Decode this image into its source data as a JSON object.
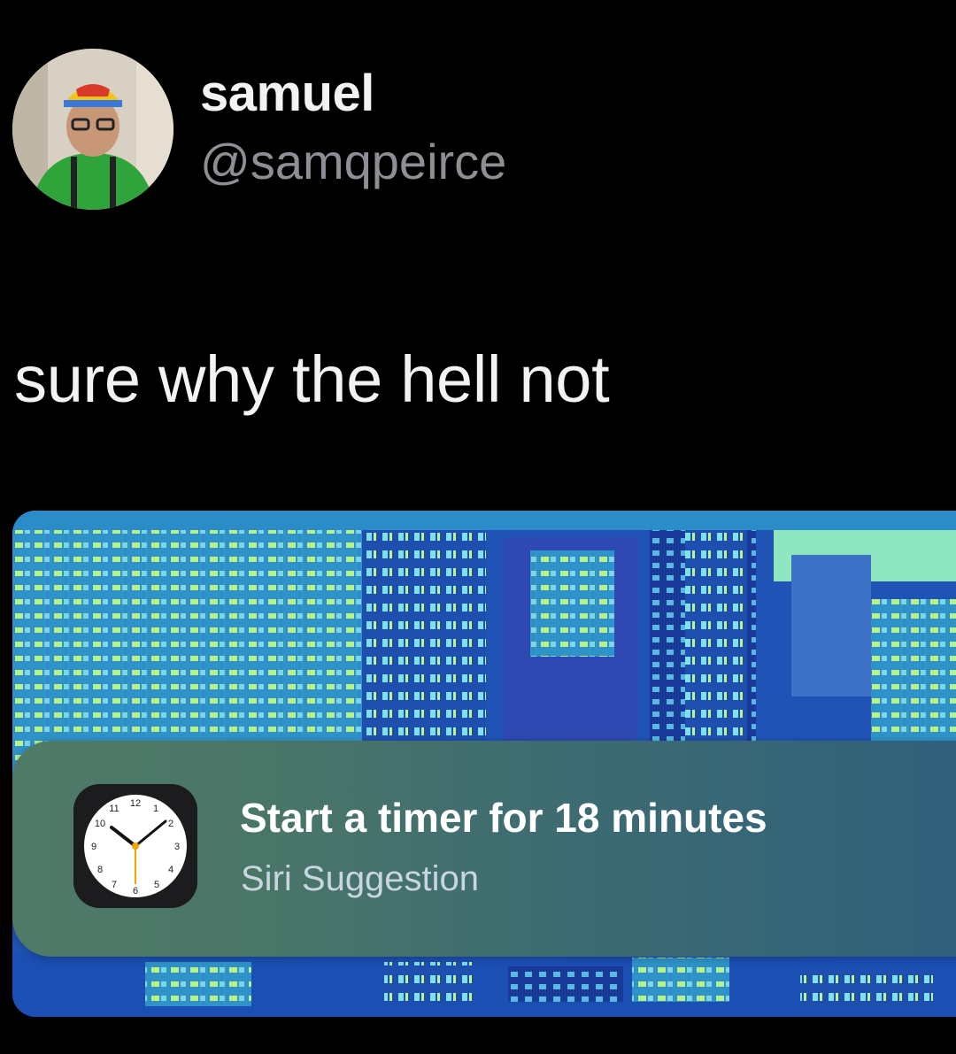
{
  "tweet": {
    "author_name": "samuel",
    "author_handle": "@samqpeirce",
    "text": "sure why the hell not"
  },
  "notification": {
    "title": "Start a timer for 18 minutes",
    "subtitle": "Siri Suggestion",
    "app_icon": "clock-icon"
  },
  "colors": {
    "background": "#000000",
    "handle": "#8d8f94",
    "banner_start": "#4f7a68",
    "banner_end": "#2f5f7c"
  }
}
